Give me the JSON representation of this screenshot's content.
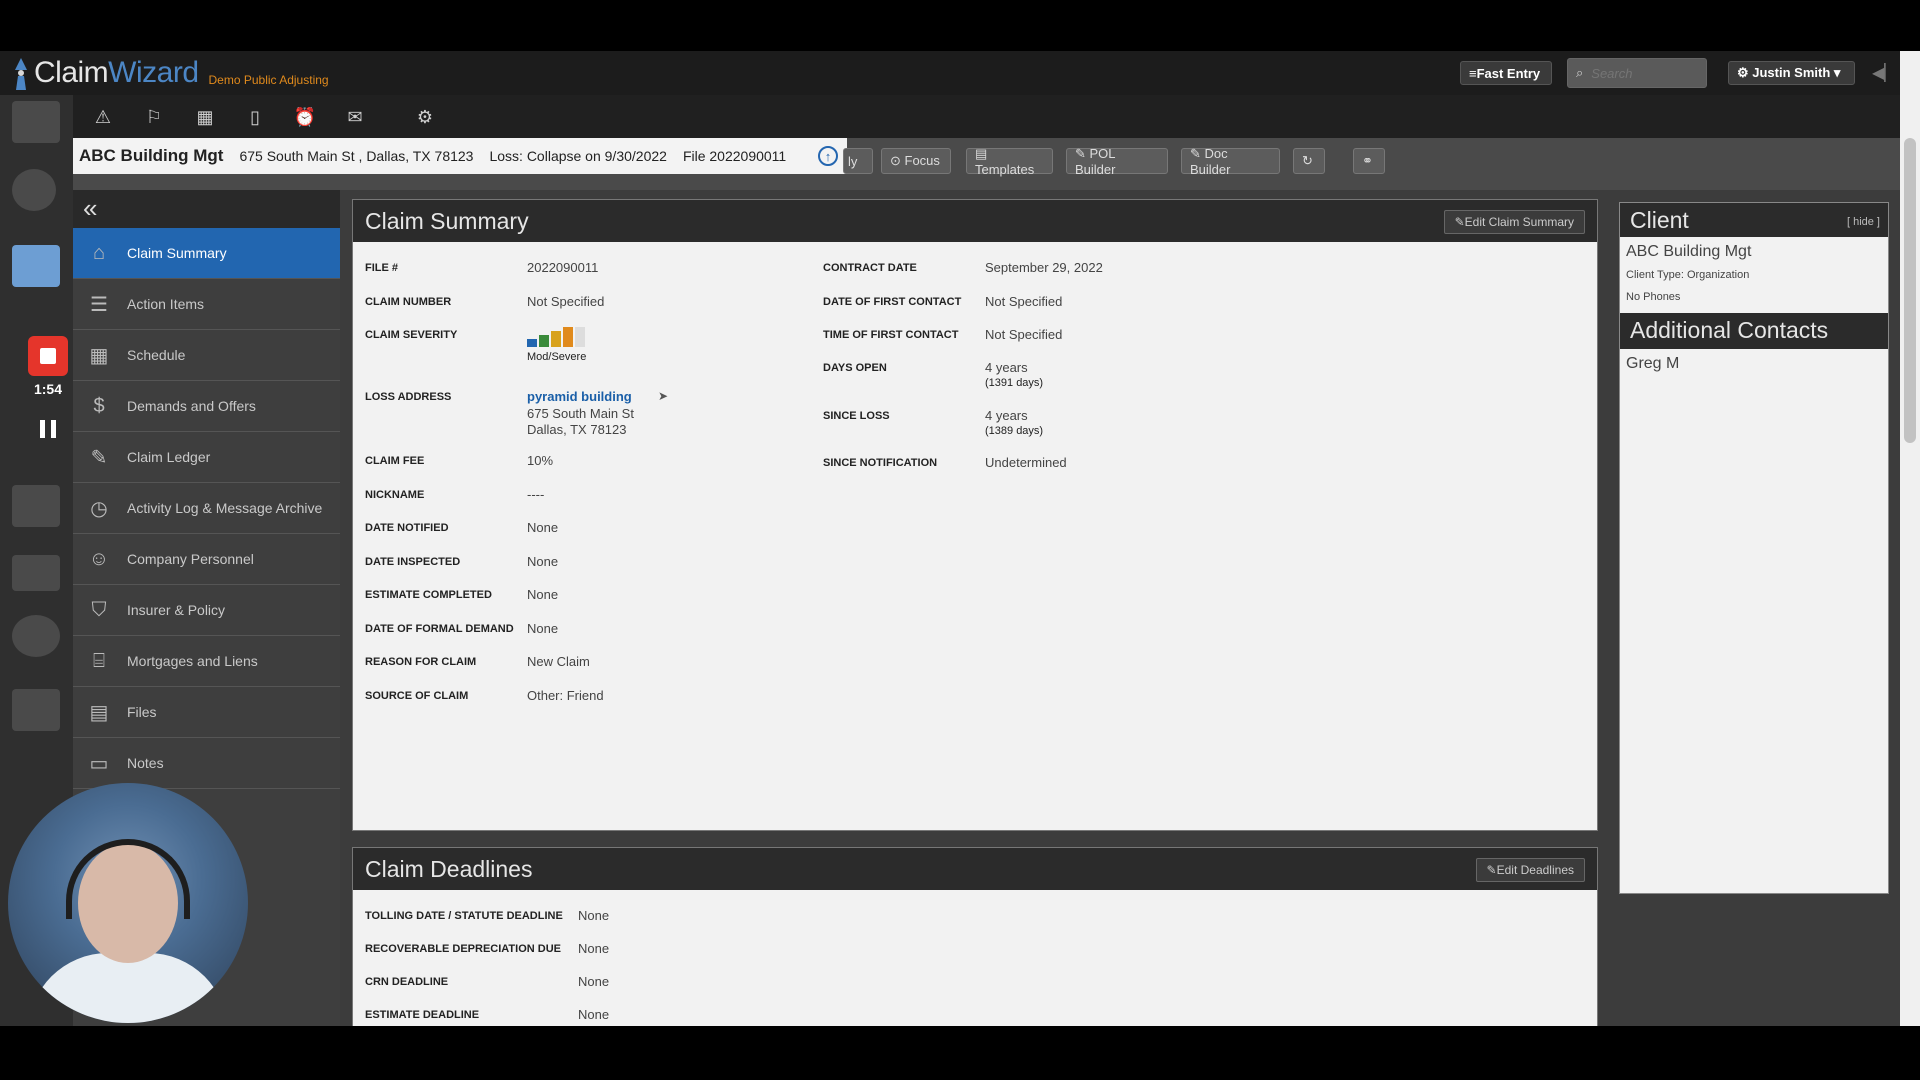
{
  "brand": {
    "name_part1": "Claim",
    "name_part2": "Wizard",
    "subtitle": "Demo Public Adjusting"
  },
  "topbar": {
    "fast_entry": "≡Fast Entry",
    "search_placeholder": "Search",
    "user": "⚙ Justin Smith ▾"
  },
  "claim_header": {
    "name": "ABC Building Mgt",
    "address": "675 South Main St , Dallas, TX 78123",
    "loss": "Loss: Collapse on 9/30/2022",
    "file": "File 2022090011"
  },
  "toolbar": {
    "partial": "ly",
    "focus": "⊙ Focus",
    "templates": "▤ Templates",
    "pol_builder": "✎ POL Builder",
    "doc_builder": "✎ Doc Builder"
  },
  "sidebar": {
    "collapse": "«",
    "items": [
      {
        "label": "Claim Summary",
        "icon": "house-icon"
      },
      {
        "label": "Action Items",
        "icon": "checklist-icon"
      },
      {
        "label": "Schedule",
        "icon": "calendar-icon"
      },
      {
        "label": "Demands and Offers",
        "icon": "money-hand-icon"
      },
      {
        "label": "Claim Ledger",
        "icon": "ledger-icon"
      },
      {
        "label": "Activity Log & Message Archive",
        "icon": "clock-icon"
      },
      {
        "label": "Company Personnel",
        "icon": "people-icon"
      },
      {
        "label": "Insurer & Policy",
        "icon": "shield-icon"
      },
      {
        "label": "Mortgages and Liens",
        "icon": "bank-icon"
      },
      {
        "label": "Files",
        "icon": "files-icon"
      },
      {
        "label": "Notes",
        "icon": "notes-icon"
      }
    ]
  },
  "claim_summary": {
    "title": "Claim Summary",
    "edit_label": "Edit Claim Summary",
    "left": [
      {
        "label": "FILE #",
        "value": "2022090011"
      },
      {
        "label": "CLAIM NUMBER",
        "value": "Not Specified"
      },
      {
        "label": "CLAIM SEVERITY",
        "value": "Mod/Severe"
      },
      {
        "label": "LOSS ADDRESS",
        "link": "pyramid building",
        "line1": "675 South Main St",
        "line2": "Dallas, TX 78123"
      },
      {
        "label": "CLAIM FEE",
        "value": "10%"
      },
      {
        "label": "NICKNAME",
        "value": "----"
      },
      {
        "label": "DATE NOTIFIED",
        "value": "None"
      },
      {
        "label": "DATE INSPECTED",
        "value": "None"
      },
      {
        "label": "ESTIMATE COMPLETED",
        "value": "None"
      },
      {
        "label": "DATE OF FORMAL DEMAND",
        "value": "None"
      },
      {
        "label": "REASON FOR CLAIM",
        "value": "New Claim"
      },
      {
        "label": "SOURCE OF CLAIM",
        "value": "Other: Friend"
      }
    ],
    "right": [
      {
        "label": "CONTRACT DATE",
        "value": "September 29, 2022"
      },
      {
        "label": "DATE OF FIRST CONTACT",
        "value": "Not Specified"
      },
      {
        "label": "TIME OF FIRST CONTACT",
        "value": "Not Specified"
      },
      {
        "label": "DAYS OPEN",
        "value": "4 years",
        "sub": "(1391 days)"
      },
      {
        "label": "SINCE LOSS",
        "value": "4 years",
        "sub": "(1389 days)"
      },
      {
        "label": "SINCE NOTIFICATION",
        "value": "Undetermined"
      }
    ],
    "severity_colors": [
      "#2266b0",
      "#3a8a3a",
      "#d8a21c",
      "#e08a1c"
    ]
  },
  "deadlines": {
    "title": "Claim Deadlines",
    "edit_label": "Edit Deadlines",
    "rows": [
      {
        "label": "TOLLING DATE / STATUTE DEADLINE",
        "value": "None"
      },
      {
        "label": "RECOVERABLE DEPRECIATION DUE",
        "value": "None"
      },
      {
        "label": "CRN DEADLINE",
        "value": "None"
      },
      {
        "label": "ESTIMATE DEADLINE",
        "value": "None"
      }
    ]
  },
  "client": {
    "title": "Client",
    "hide": "[ hide ]",
    "name": "ABC Building Mgt",
    "type": "Client Type: Organization",
    "phones": "No Phones",
    "contacts_title": "Additional Contacts",
    "contact": "Greg M"
  },
  "recorder": {
    "time": "1:54"
  }
}
